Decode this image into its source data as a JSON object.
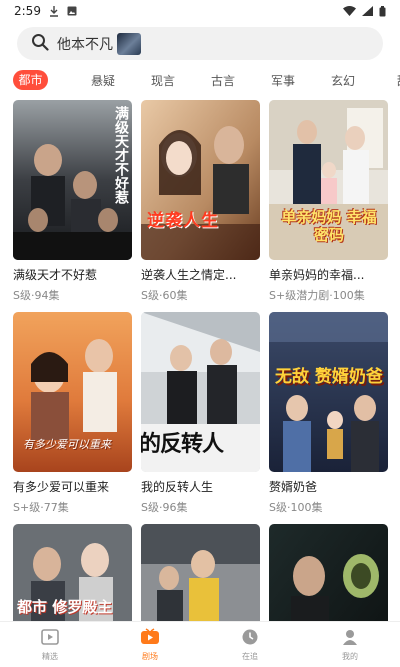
{
  "status_bar": {
    "time": "2:59"
  },
  "search": {
    "text": "他本不凡"
  },
  "tabs": [
    {
      "label": "都市",
      "active": true
    },
    {
      "label": "悬疑"
    },
    {
      "label": "现言"
    },
    {
      "label": "古言"
    },
    {
      "label": "军事"
    },
    {
      "label": "玄幻"
    },
    {
      "label": "甜"
    }
  ],
  "cards": [
    {
      "title": "满级天才不好惹",
      "meta": "S级·94集",
      "poster_text": "满级天才不好惹"
    },
    {
      "title": "逆袭人生之情定...",
      "meta": "S级·60集",
      "poster_text": "逆袭人生"
    },
    {
      "title": "单亲妈妈的幸福...",
      "meta": "S+级潜力剧·100集",
      "poster_text": "单亲妈妈 幸福密码"
    },
    {
      "title": "有多少爱可以重来",
      "meta": "S+级·77集",
      "poster_text": "有多少爱可以重来"
    },
    {
      "title": "我的反转人生",
      "meta": "S级·96集",
      "poster_text": "的反转人"
    },
    {
      "title": "赘婿奶爸",
      "meta": "S级·100集",
      "poster_text": "无敌 赘婿奶爸"
    },
    {
      "title": "",
      "meta": "",
      "poster_text": "都市 修罗殿主"
    },
    {
      "title": "",
      "meta": "",
      "poster_text": ""
    },
    {
      "title": "",
      "meta": "",
      "poster_text": ""
    }
  ],
  "bottom_nav": [
    {
      "label": "精选",
      "icon": "play-square-icon"
    },
    {
      "label": "剧场",
      "icon": "theater-play-icon",
      "active": true
    },
    {
      "label": "在追",
      "icon": "clock-icon"
    },
    {
      "label": "我的",
      "icon": "person-icon"
    }
  ],
  "colors": {
    "accent": "#ff4e3b",
    "nav_active": "#ff7a1a",
    "search_bg": "#f1f1f1"
  }
}
